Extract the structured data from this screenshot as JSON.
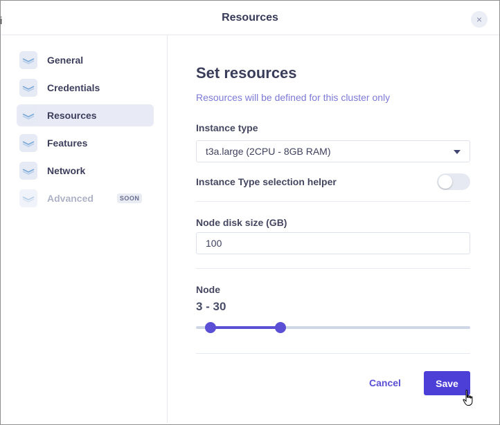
{
  "window": {
    "stray_char": "i"
  },
  "header": {
    "title": "Resources",
    "close_icon": "close-icon",
    "close_glyph": "×"
  },
  "sidebar": {
    "items": [
      {
        "label": "General",
        "icon": "layers-icon",
        "active": false,
        "disabled": false
      },
      {
        "label": "Credentials",
        "icon": "layers-icon",
        "active": false,
        "disabled": false
      },
      {
        "label": "Resources",
        "icon": "layers-icon",
        "active": true,
        "disabled": false
      },
      {
        "label": "Features",
        "icon": "layers-icon",
        "active": false,
        "disabled": false
      },
      {
        "label": "Network",
        "icon": "layers-icon",
        "active": false,
        "disabled": false
      },
      {
        "label": "Advanced",
        "icon": "layers-icon",
        "active": false,
        "disabled": true,
        "badge": "SOON"
      }
    ]
  },
  "main": {
    "title": "Set resources",
    "subtitle": "Resources will be defined for this cluster only",
    "instance_type": {
      "label": "Instance type",
      "value": "t3a.large (2CPU - 8GB RAM)"
    },
    "selection_helper": {
      "label": "Instance Type selection helper",
      "enabled": false
    },
    "disk_size": {
      "label": "Node disk size (GB)",
      "value": "100"
    },
    "node": {
      "label": "Node",
      "range_text": "3 - 30",
      "min": 3,
      "max": 30
    }
  },
  "footer": {
    "cancel_label": "Cancel",
    "save_label": "Save"
  },
  "colors": {
    "accent": "#4b3fd7",
    "subtitle": "#7d79d6"
  }
}
